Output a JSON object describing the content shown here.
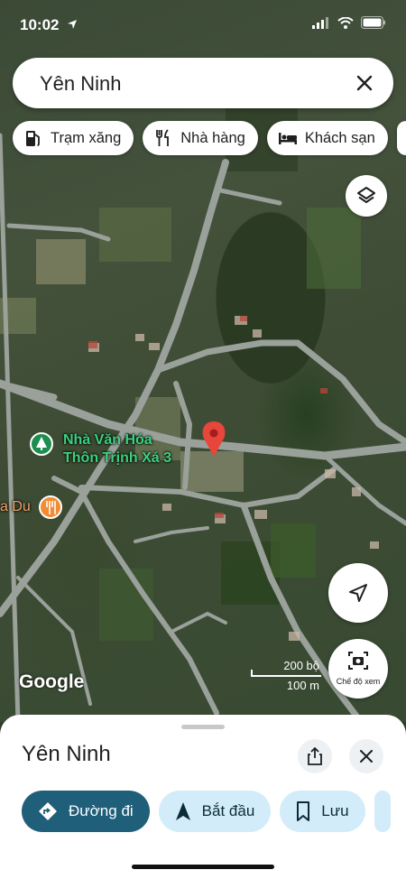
{
  "status_bar": {
    "time": "10:02"
  },
  "search": {
    "query": "Yên Ninh"
  },
  "chips": [
    {
      "label": "Trạm xăng",
      "icon": "gas-station-icon"
    },
    {
      "label": "Nhà hàng",
      "icon": "restaurant-icon"
    },
    {
      "label": "Khách sạn",
      "icon": "hotel-icon"
    }
  ],
  "map": {
    "poi_culture_house": "Nhà Văn Hóa\nThôn Trịnh Xá 3",
    "poi_partial": "a Du",
    "attribution": "Google",
    "scale_top": "200 bộ",
    "scale_bottom": "100 m",
    "view_mode_label": "Chế độ xem"
  },
  "sheet": {
    "title": "Yên Ninh",
    "actions": [
      {
        "label": "Đường đi",
        "icon": "directions-icon"
      },
      {
        "label": "Bắt đầu",
        "icon": "navigation-arrow-icon"
      },
      {
        "label": "Lưu",
        "icon": "bookmark-icon"
      }
    ]
  },
  "colors": {
    "primary_action": "#1f5f7a",
    "secondary_action": "#d3ecf9",
    "pin": "#e8453c"
  }
}
